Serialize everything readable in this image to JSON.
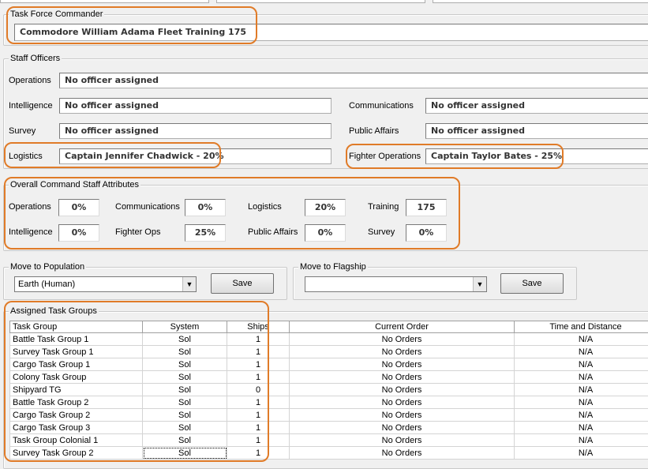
{
  "commander": {
    "group_title": "Task Force Commander",
    "value": "Commodore William Adama    Fleet Training 175"
  },
  "staff": {
    "group_title": "Staff Officers",
    "operations": {
      "label": "Operations",
      "value": "No officer assigned"
    },
    "intelligence": {
      "label": "Intelligence",
      "value": "No officer assigned"
    },
    "communications": {
      "label": "Communications",
      "value": "No officer assigned"
    },
    "survey": {
      "label": "Survey",
      "value": "No officer assigned"
    },
    "public_affairs": {
      "label": "Public Affairs",
      "value": "No officer assigned"
    },
    "logistics": {
      "label": "Logistics",
      "value": "Captain Jennifer Chadwick - 20%"
    },
    "fighter_ops": {
      "label": "Fighter Operations",
      "value": "Captain Taylor Bates - 25%"
    }
  },
  "attributes": {
    "group_title": "Overall Command Staff Attributes",
    "operations": {
      "label": "Operations",
      "value": "0%"
    },
    "communications": {
      "label": "Communications",
      "value": "0%"
    },
    "logistics": {
      "label": "Logistics",
      "value": "20%"
    },
    "training": {
      "label": "Training",
      "value": "175"
    },
    "intelligence": {
      "label": "Intelligence",
      "value": "0%"
    },
    "fighter_ops": {
      "label": "Fighter Ops",
      "value": "25%"
    },
    "public_affairs": {
      "label": "Public Affairs",
      "value": "0%"
    },
    "survey": {
      "label": "Survey",
      "value": "0%"
    }
  },
  "move_population": {
    "group_title": "Move to Population",
    "selected": "Earth (Human)",
    "save_label": "Save"
  },
  "move_flagship": {
    "group_title": "Move to Flagship",
    "selected": "",
    "save_label": "Save"
  },
  "task_groups": {
    "group_title": "Assigned Task Groups",
    "columns": [
      "Task Group",
      "System",
      "Ships",
      "Current Order",
      "Time and Distance"
    ],
    "rows": [
      [
        "Battle Task Group 1",
        "Sol",
        "1",
        "No Orders",
        "N/A"
      ],
      [
        "Survey Task Group 1",
        "Sol",
        "1",
        "No Orders",
        "N/A"
      ],
      [
        "Cargo Task Group 1",
        "Sol",
        "1",
        "No Orders",
        "N/A"
      ],
      [
        "Colony Task Group",
        "Sol",
        "1",
        "No Orders",
        "N/A"
      ],
      [
        "Shipyard TG",
        "Sol",
        "0",
        "No Orders",
        "N/A"
      ],
      [
        "Battle Task Group 2",
        "Sol",
        "1",
        "No Orders",
        "N/A"
      ],
      [
        "Cargo Task Group 2",
        "Sol",
        "1",
        "No Orders",
        "N/A"
      ],
      [
        "Cargo Task Group 3",
        "Sol",
        "1",
        "No Orders",
        "N/A"
      ],
      [
        "Task Group Colonial 1",
        "Sol",
        "1",
        "No Orders",
        "N/A"
      ],
      [
        "Survey Task Group 2",
        "Sol",
        "1",
        "No Orders",
        "N/A"
      ]
    ]
  },
  "highlight_color": "#e07b28"
}
